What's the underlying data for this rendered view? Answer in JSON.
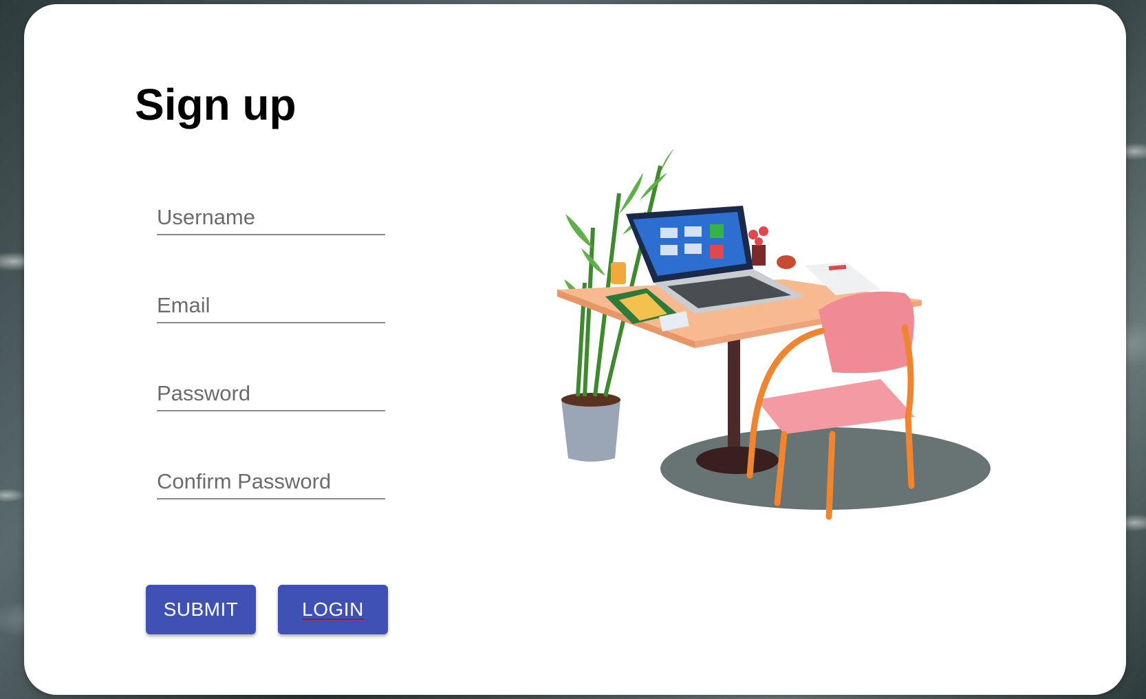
{
  "form": {
    "title": "Sign up",
    "fields": [
      {
        "name": "username",
        "placeholder": "Username",
        "value": ""
      },
      {
        "name": "email",
        "placeholder": "Email",
        "value": ""
      },
      {
        "name": "password",
        "placeholder": "Password",
        "value": ""
      },
      {
        "name": "confirm_password",
        "placeholder": "Confirm Password",
        "value": ""
      }
    ],
    "buttons": {
      "submit_label": "SUBMIT",
      "login_label": "LOGIN"
    }
  },
  "colors": {
    "accent": "#3f51b5",
    "card": "#ffffff"
  }
}
